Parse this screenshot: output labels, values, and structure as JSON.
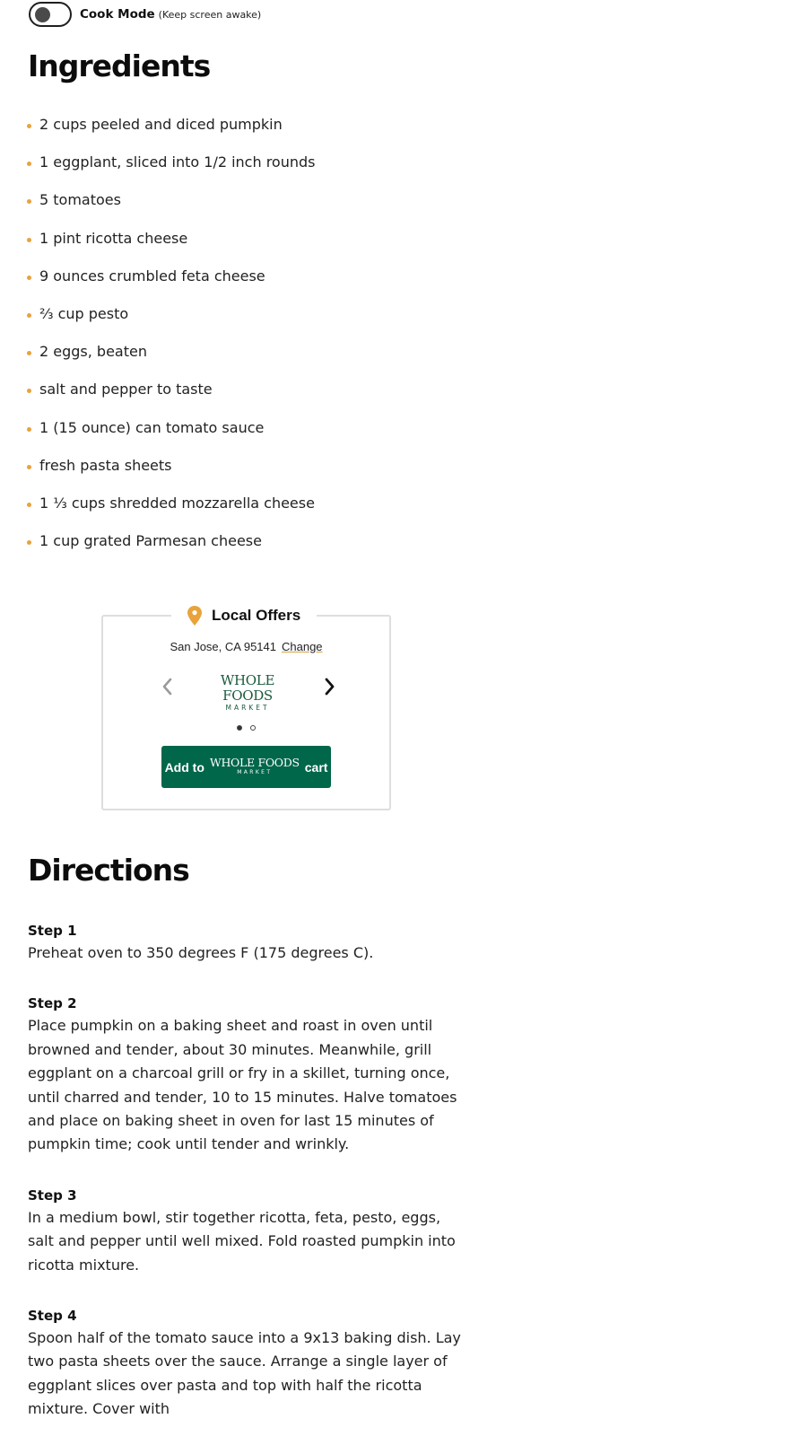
{
  "cook_mode": {
    "label": "Cook Mode",
    "sublabel": "(Keep screen awake)",
    "enabled": false
  },
  "ingredients": {
    "heading": "Ingredients",
    "items": [
      "2 cups peeled and diced pumpkin",
      "1 eggplant, sliced into 1/2 inch rounds",
      "5 tomatoes",
      "1 pint ricotta cheese",
      "9 ounces crumbled feta cheese",
      "⅔ cup pesto",
      "2 eggs, beaten",
      "salt and pepper to taste",
      "1 (15 ounce) can tomato sauce",
      "fresh pasta sheets",
      "1 ⅓ cups shredded mozzarella cheese",
      "1 cup grated Parmesan cheese"
    ]
  },
  "local_offers": {
    "title": "Local Offers",
    "location": "San Jose, CA 95141",
    "change_label": "Change",
    "store_logo": {
      "name": "WHOLE FOODS",
      "sub": "MARKET"
    },
    "carousel_page": 1,
    "carousel_total": 2,
    "cart_button": {
      "prefix": "Add to",
      "logo_name": "WHOLE FOODS",
      "logo_sub": "MARKET",
      "suffix": "cart"
    },
    "accent_color": "#00674b",
    "pin_color": "#e8a33b"
  },
  "directions": {
    "heading": "Directions",
    "steps": [
      {
        "label": "Step 1",
        "text": "Preheat oven to 350 degrees F (175 degrees C)."
      },
      {
        "label": "Step 2",
        "text": "Place pumpkin on a baking sheet and roast in oven until browned and tender, about 30 minutes. Meanwhile, grill eggplant on a charcoal grill or fry in a skillet, turning once, until charred and tender, 10 to 15 minutes. Halve tomatoes and place on baking sheet in oven for last 15 minutes of pumpkin time; cook until tender and wrinkly."
      },
      {
        "label": "Step 3",
        "text": "In a medium bowl, stir together ricotta, feta, pesto, eggs, salt and pepper until well mixed. Fold roasted pumpkin into ricotta mixture."
      },
      {
        "label": "Step 4",
        "text": "Spoon half of the tomato sauce into a 9x13 baking dish. Lay two pasta sheets over the sauce. Arrange a single layer of eggplant slices over pasta and top with half the ricotta mixture. Cover with"
      }
    ]
  }
}
